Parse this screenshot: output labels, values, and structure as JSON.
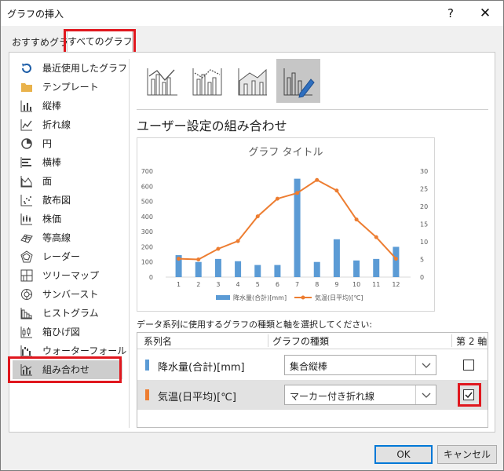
{
  "window": {
    "title": "グラフの挿入",
    "help": "?",
    "close": "✕"
  },
  "tabs": [
    {
      "label": "おすすめグラフ",
      "selected": false
    },
    {
      "label": "すべてのグラフ",
      "selected": true
    }
  ],
  "sidebar": {
    "items": [
      {
        "label": "最近使用したグラフ",
        "icon": "recent-icon"
      },
      {
        "label": "テンプレート",
        "icon": "folder-icon"
      },
      {
        "label": "縦棒",
        "icon": "column-chart-icon"
      },
      {
        "label": "折れ線",
        "icon": "line-chart-icon"
      },
      {
        "label": "円",
        "icon": "pie-chart-icon"
      },
      {
        "label": "横棒",
        "icon": "bar-chart-icon"
      },
      {
        "label": "面",
        "icon": "area-chart-icon"
      },
      {
        "label": "散布図",
        "icon": "scatter-chart-icon"
      },
      {
        "label": "株価",
        "icon": "stock-chart-icon"
      },
      {
        "label": "等高線",
        "icon": "surface-chart-icon"
      },
      {
        "label": "レーダー",
        "icon": "radar-chart-icon"
      },
      {
        "label": "ツリーマップ",
        "icon": "treemap-chart-icon"
      },
      {
        "label": "サンバースト",
        "icon": "sunburst-chart-icon"
      },
      {
        "label": "ヒストグラム",
        "icon": "histogram-chart-icon"
      },
      {
        "label": "箱ひげ図",
        "icon": "boxwhisker-chart-icon"
      },
      {
        "label": "ウォーターフォール",
        "icon": "waterfall-chart-icon"
      },
      {
        "label": "組み合わせ",
        "icon": "combo-chart-icon",
        "selected": true
      }
    ]
  },
  "subtypes": [
    {
      "icon": "combo-column-line-icon"
    },
    {
      "icon": "combo-column-line-secondary-icon"
    },
    {
      "icon": "combo-area-column-icon"
    },
    {
      "icon": "custom-combo-icon",
      "selected": true
    }
  ],
  "section_title": "ユーザー設定の組み合わせ",
  "chart_data": {
    "type": "bar",
    "title": "グラフ タイトル",
    "categories": [
      "1",
      "2",
      "3",
      "4",
      "5",
      "6",
      "7",
      "8",
      "9",
      "10",
      "11",
      "12"
    ],
    "series": [
      {
        "name": "降水量(合計)[mm]",
        "type": "bar",
        "axis": "primary",
        "color": "#5b9bd5",
        "values": [
          145,
          100,
          120,
          105,
          80,
          80,
          650,
          100,
          250,
          110,
          120,
          200
        ]
      },
      {
        "name": "気温(日平均)[℃]",
        "type": "line",
        "axis": "secondary",
        "color": "#ed7d31",
        "values": [
          5.2,
          5.0,
          8.0,
          10.2,
          17.2,
          22.2,
          23.8,
          27.5,
          24.5,
          16.3,
          11.3,
          5.2
        ]
      }
    ],
    "y_ticks": [
      "0",
      "100",
      "200",
      "300",
      "400",
      "500",
      "600",
      "700"
    ],
    "y2_ticks": [
      "0",
      "5",
      "10",
      "15",
      "20",
      "25",
      "30"
    ],
    "ylim": [
      0,
      700
    ],
    "y2lim": [
      0,
      30
    ],
    "legend_position": "bottom",
    "grid": false
  },
  "instruction": "データ系列に使用するグラフの種類と軸を選択してください:",
  "table": {
    "headers": {
      "name": "系列名",
      "type": "グラフの種類",
      "axis": "第 2 軸"
    },
    "rows": [
      {
        "name": "降水量(合計)[mm]",
        "type": "集合縦棒",
        "secondary": false,
        "color": "#5b9bd5"
      },
      {
        "name": "気温(日平均)[℃]",
        "type": "マーカー付き折れ線",
        "secondary": true,
        "color": "#ed7d31"
      }
    ]
  },
  "buttons": {
    "ok": "OK",
    "cancel": "キャンセル"
  },
  "colors": {
    "highlight": "#e0171e",
    "selected_bg": "#cdcdcd",
    "bar": "#5b9bd5",
    "line": "#ed7d31"
  }
}
